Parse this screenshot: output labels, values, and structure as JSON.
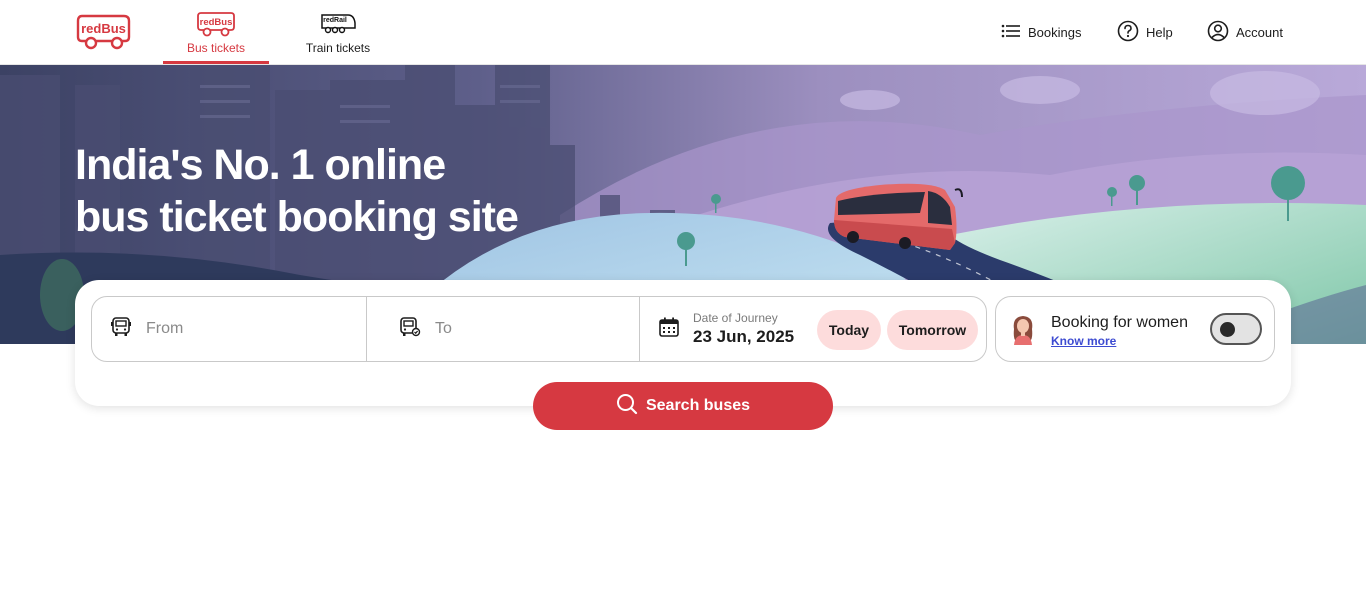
{
  "brand": {
    "logo_text": "redBus",
    "rail_logo_text": "redRail"
  },
  "nav": {
    "tabs": [
      {
        "label": "Bus tickets",
        "icon": "redbus-logo-icon",
        "active": true
      },
      {
        "label": "Train tickets",
        "icon": "redrail-train-icon",
        "active": false
      }
    ],
    "right": {
      "bookings": "Bookings",
      "help": "Help",
      "account": "Account"
    }
  },
  "hero": {
    "title_line1": "India's No. 1 online",
    "title_line2": "bus ticket booking site"
  },
  "search": {
    "from_placeholder": "From",
    "to_placeholder": "To",
    "date_label": "Date of Journey",
    "date_value": "23 Jun, 2025",
    "today_label": "Today",
    "tomorrow_label": "Tomorrow",
    "women_title": "Booking for women",
    "women_link": "Know more",
    "women_toggle_on": false,
    "button_label": "Search buses"
  },
  "colors": {
    "accent": "#d63941",
    "chip_bg": "#fddcdc",
    "link": "#3d4bd1"
  }
}
